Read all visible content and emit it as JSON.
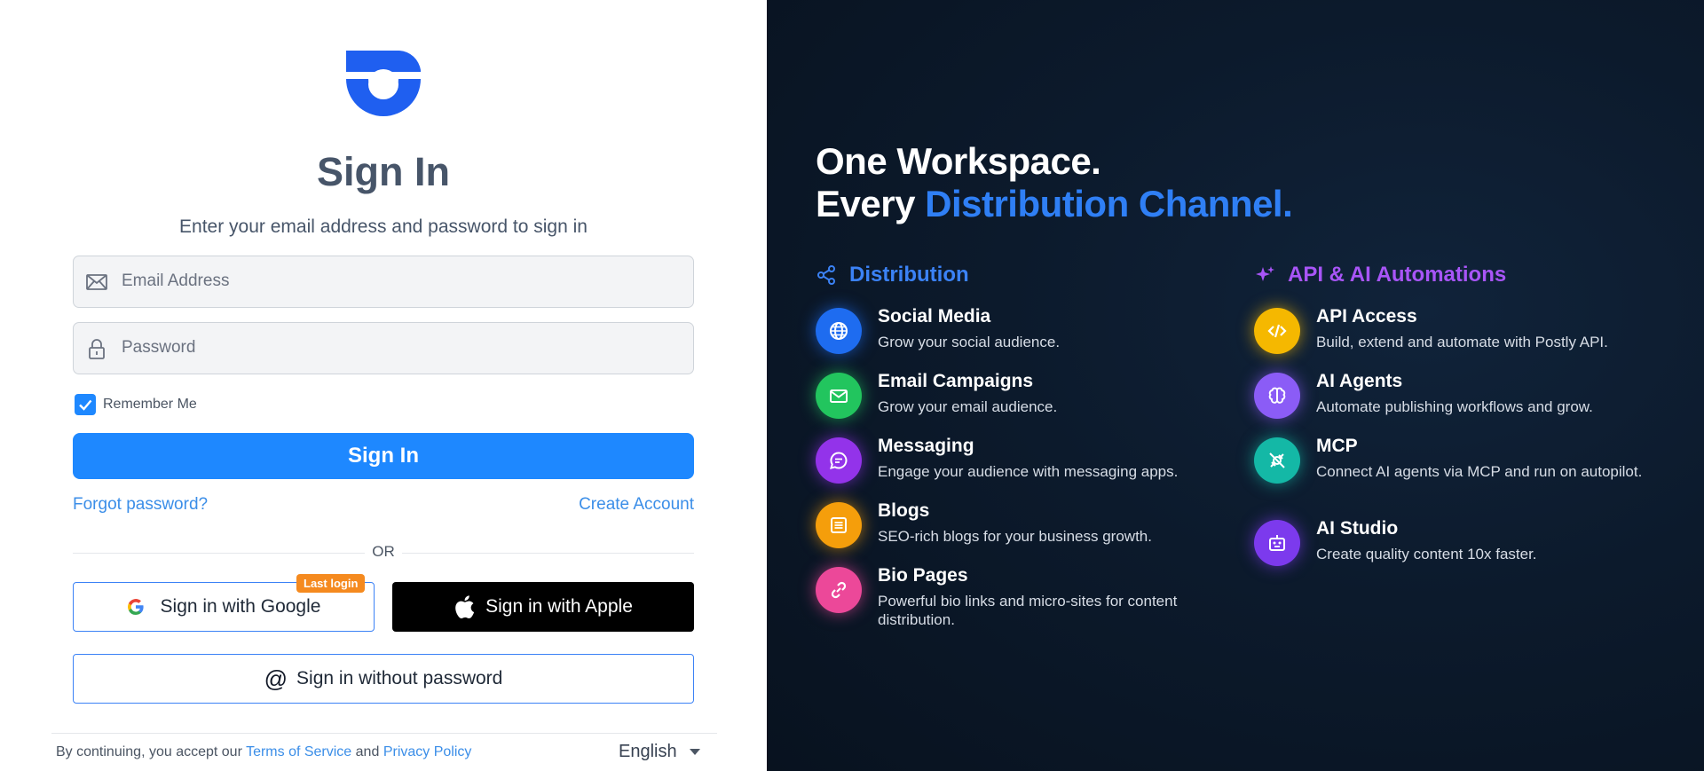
{
  "signin": {
    "title": "Sign In",
    "subtitle": "Enter your email address and password to sign in",
    "email_placeholder": "Email Address",
    "password_placeholder": "Password",
    "remember_label": "Remember Me",
    "remember_checked": true,
    "submit_label": "Sign In",
    "forgot_label": "Forgot password?",
    "create_label": "Create Account",
    "or_label": "OR",
    "google_label": "Sign in with Google",
    "last_login_badge": "Last login",
    "apple_label": "Sign in with Apple",
    "passwordless_label": "Sign in without password",
    "terms_prefix": "By continuing, you accept our",
    "terms_link": "Terms of Service",
    "terms_and": "and",
    "privacy_link": "Privacy Policy",
    "language": "English"
  },
  "promo": {
    "headline_line1": "One Workspace.",
    "headline_line2_prefix": "Every",
    "headline_line2_accent": "Distribution Channel.",
    "distribution": {
      "title": "Distribution",
      "items": [
        {
          "title": "Social Media",
          "desc": "Grow your social audience.",
          "icon": "globe-icon",
          "color": "#1e6cf0"
        },
        {
          "title": "Email Campaigns",
          "desc": "Grow your email audience.",
          "icon": "mail-icon",
          "color": "#22c55e"
        },
        {
          "title": "Messaging",
          "desc": "Engage your audience with messaging apps.",
          "icon": "chat-icon",
          "color": "#9333ea"
        },
        {
          "title": "Blogs",
          "desc": "SEO-rich blogs for your business growth.",
          "icon": "article-icon",
          "color": "#f59e0b"
        },
        {
          "title": "Bio Pages",
          "desc": "Powerful bio links and micro-sites for content distribution.",
          "icon": "link-icon",
          "color": "#ec4899"
        }
      ]
    },
    "automations": {
      "title": "API & AI Automations",
      "items": [
        {
          "title": "API Access",
          "desc": "Build, extend and automate with Postly API.",
          "icon": "code-icon",
          "color": "#f5b800"
        },
        {
          "title": "AI Agents",
          "desc": "Automate publishing workflows and grow.",
          "icon": "brain-icon",
          "color": "#8b5cf6"
        },
        {
          "title": "MCP",
          "desc": "Connect AI agents via MCP and run on autopilot.",
          "icon": "plug-icon",
          "color": "#14b8a6"
        },
        {
          "title": "AI Studio",
          "desc": "Create quality content 10x faster.",
          "icon": "robot-icon",
          "color": "#7c3aed"
        }
      ]
    }
  },
  "colors": {
    "primary": "#1e88ff",
    "link": "#3b8ee8",
    "dark_bg": "#0c1a2c",
    "badge": "#f58a1f"
  }
}
